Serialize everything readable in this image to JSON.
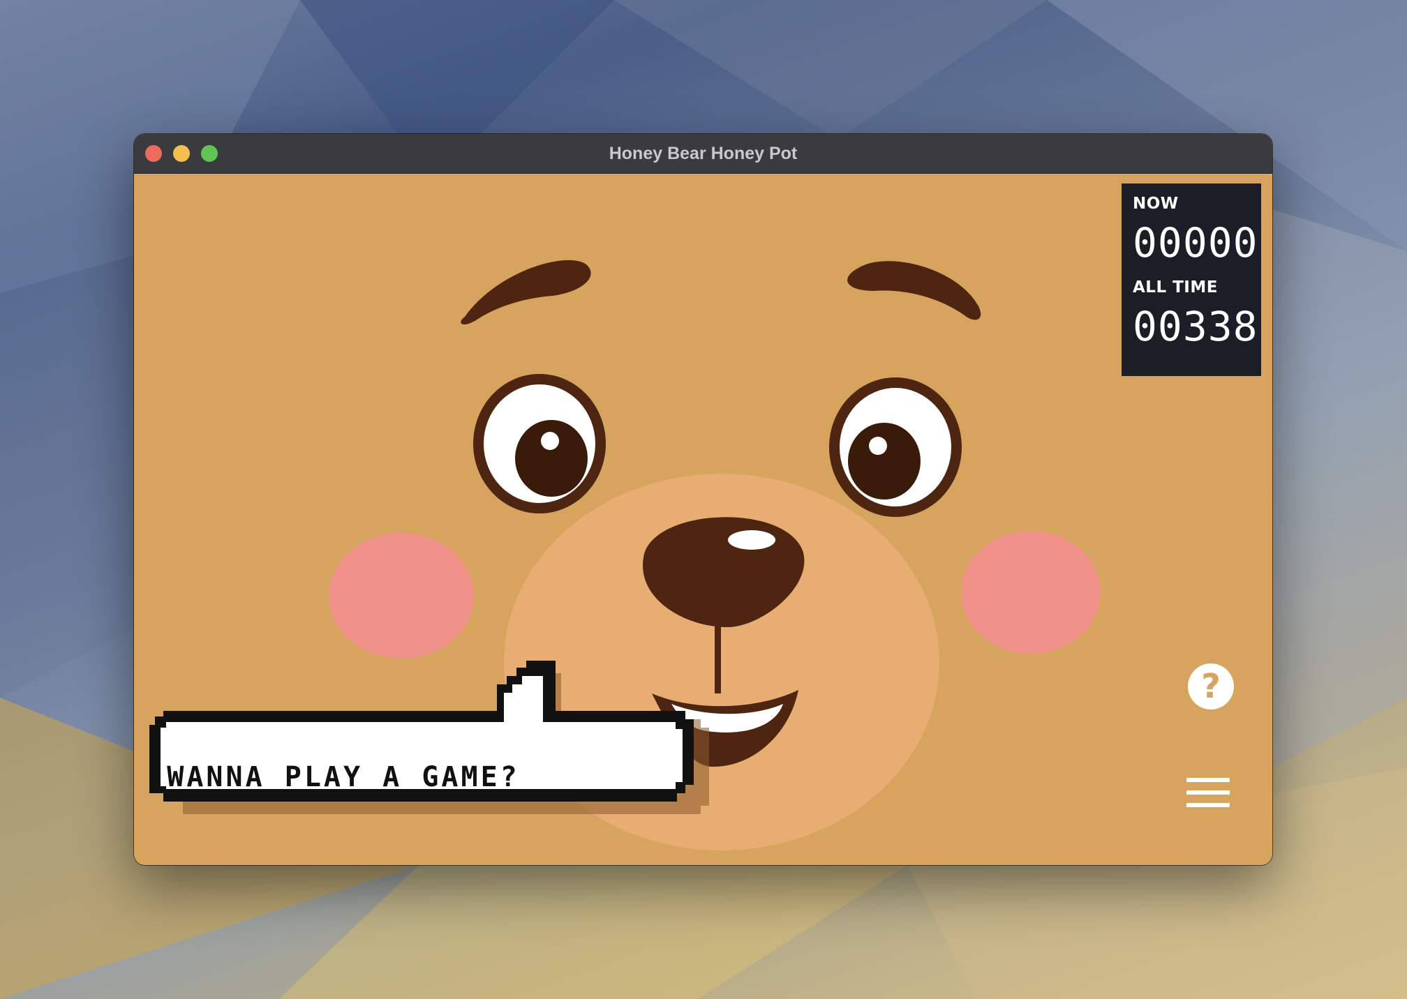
{
  "window": {
    "title": "Honey Bear Honey Pot"
  },
  "scoreboard": {
    "now_label": "NOW",
    "now_value": "00000",
    "alltime_label": "ALL TIME",
    "alltime_value": "00338"
  },
  "speech_bubble": {
    "text": "WANNA PLAY A GAME?"
  },
  "controls": {
    "help_label": "?",
    "help_icon": "question-icon",
    "menu_icon": "hamburger-menu-icon"
  },
  "colors": {
    "fur": "#d7a45f",
    "muzzle": "#e8ad72",
    "brown": "#4e2510",
    "cheek": "#f0918a",
    "panel": "#1b1e26"
  }
}
